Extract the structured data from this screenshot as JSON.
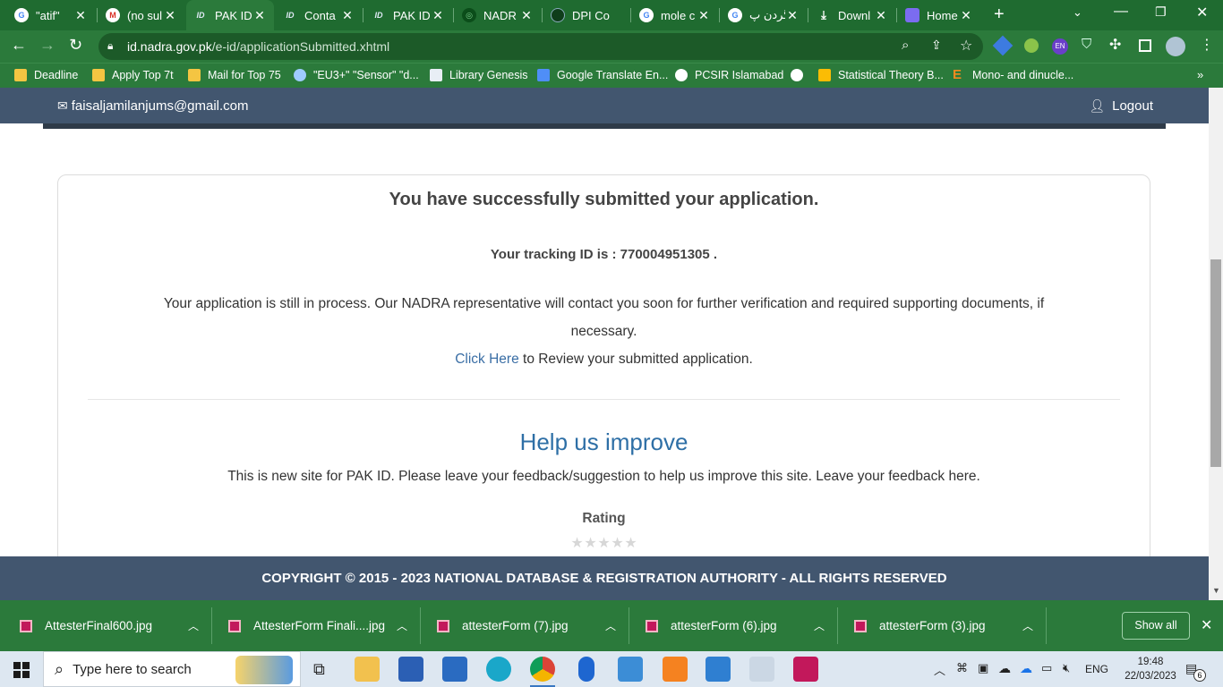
{
  "browser": {
    "tabs": [
      {
        "title": "\"atif\"",
        "favicon": "google-icon"
      },
      {
        "title": "(no sul",
        "favicon": "gmail-icon"
      },
      {
        "title": "PAK ID",
        "favicon": "id-icon",
        "active": true
      },
      {
        "title": "Conta",
        "favicon": "id-icon"
      },
      {
        "title": "PAK ID",
        "favicon": "id-icon"
      },
      {
        "title": "NADR",
        "favicon": "nadra-icon"
      },
      {
        "title": "DPI Co",
        "favicon": "globe-icon"
      },
      {
        "title": "mole c",
        "favicon": "google-icon"
      },
      {
        "title": "گردن پ",
        "favicon": "google-icon"
      },
      {
        "title": "Downl",
        "favicon": "download-icon"
      },
      {
        "title": "Home",
        "favicon": "home-icon"
      }
    ],
    "url_host": "id.nadra.gov.pk",
    "url_path": "/e-id/applicationSubmitted.xhtml",
    "profile_badge": "EN",
    "bookmarks": [
      {
        "label": "Deadline"
      },
      {
        "label": "Apply Top 7t"
      },
      {
        "label": "Mail for Top 75"
      },
      {
        "label": "\"EU3+\" \"Sensor\" \"d..."
      },
      {
        "label": "Library Genesis"
      },
      {
        "label": "Google Translate En..."
      },
      {
        "label": "PCSIR Islamabad"
      },
      {
        "label": "Statistical Theory B..."
      },
      {
        "label": "Mono- and dinucle..."
      }
    ]
  },
  "page": {
    "email": "faisaljamilanjums@gmail.com",
    "logout": "Logout",
    "success_heading": "You have successfully submitted your application.",
    "tracking_text": "Your tracking ID is : 770004951305 .",
    "process_line1": "Your application is still in process. Our NADRA representative will contact you soon for further verification and required supporting documents, if",
    "process_line2": "necessary.",
    "review_link": "Click Here",
    "review_rest": " to Review your submitted application.",
    "help_heading": "Help us improve",
    "help_text": "This is new site for PAK ID. Please leave your feedback/suggestion to help us improve this site. Leave your feedback here.",
    "rating_label": "Rating",
    "rating_value": 0,
    "footer": "COPYRIGHT © 2015 - 2023 NATIONAL DATABASE & REGISTRATION AUTHORITY - ALL RIGHTS RESERVED"
  },
  "downloads": {
    "items": [
      {
        "name": "AttesterFinal600.jpg"
      },
      {
        "name": "AttesterForm Finali....jpg"
      },
      {
        "name": "attesterForm (7).jpg"
      },
      {
        "name": "attesterForm (6).jpg"
      },
      {
        "name": "attesterForm (3).jpg"
      }
    ],
    "show_all": "Show all"
  },
  "taskbar": {
    "search_placeholder": "Type here to search",
    "language": "ENG",
    "time": "19:48",
    "date": "22/03/2023",
    "notifications": "6"
  },
  "colors": {
    "chrome_green": "#2b7a3b",
    "nadra_header": "#42566f",
    "link": "#3a6ea5"
  }
}
